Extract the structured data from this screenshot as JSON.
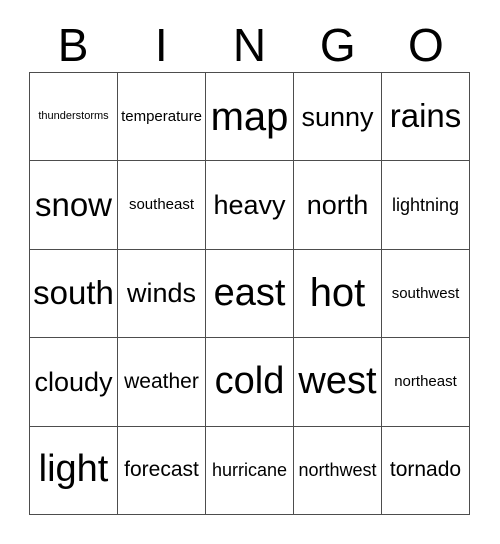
{
  "card": {
    "title_letters": [
      "B",
      "I",
      "N",
      "G",
      "O"
    ],
    "colors": {
      "background": "#ffffff",
      "text": "#000000",
      "grid_line": "#4d4d4d"
    },
    "rows": [
      [
        {
          "label": "thunderstorms",
          "size": "fs-tiny"
        },
        {
          "label": "temperature",
          "size": "fs-xxs"
        },
        {
          "label": "map",
          "size": "fs-xxl"
        },
        {
          "label": "sunny",
          "size": "fs-md"
        },
        {
          "label": "rains",
          "size": "fs-lg"
        }
      ],
      [
        {
          "label": "snow",
          "size": "fs-lg"
        },
        {
          "label": "southeast",
          "size": "fs-xxs"
        },
        {
          "label": "heavy",
          "size": "fs-md"
        },
        {
          "label": "north",
          "size": "fs-md"
        },
        {
          "label": "lightning",
          "size": "fs-xs"
        }
      ],
      [
        {
          "label": "south",
          "size": "fs-lg"
        },
        {
          "label": "winds",
          "size": "fs-md"
        },
        {
          "label": "east",
          "size": "fs-xl"
        },
        {
          "label": "hot",
          "size": "fs-xxl"
        },
        {
          "label": "southwest",
          "size": "fs-xxs"
        }
      ],
      [
        {
          "label": "cloudy",
          "size": "fs-md"
        },
        {
          "label": "weather",
          "size": "fs-sm"
        },
        {
          "label": "cold",
          "size": "fs-xl"
        },
        {
          "label": "west",
          "size": "fs-xl"
        },
        {
          "label": "northeast",
          "size": "fs-xxs"
        }
      ],
      [
        {
          "label": "light",
          "size": "fs-xl"
        },
        {
          "label": "forecast",
          "size": "fs-sm"
        },
        {
          "label": "hurricane",
          "size": "fs-xs"
        },
        {
          "label": "northwest",
          "size": "fs-xs"
        },
        {
          "label": "tornado",
          "size": "fs-sm"
        }
      ]
    ]
  }
}
